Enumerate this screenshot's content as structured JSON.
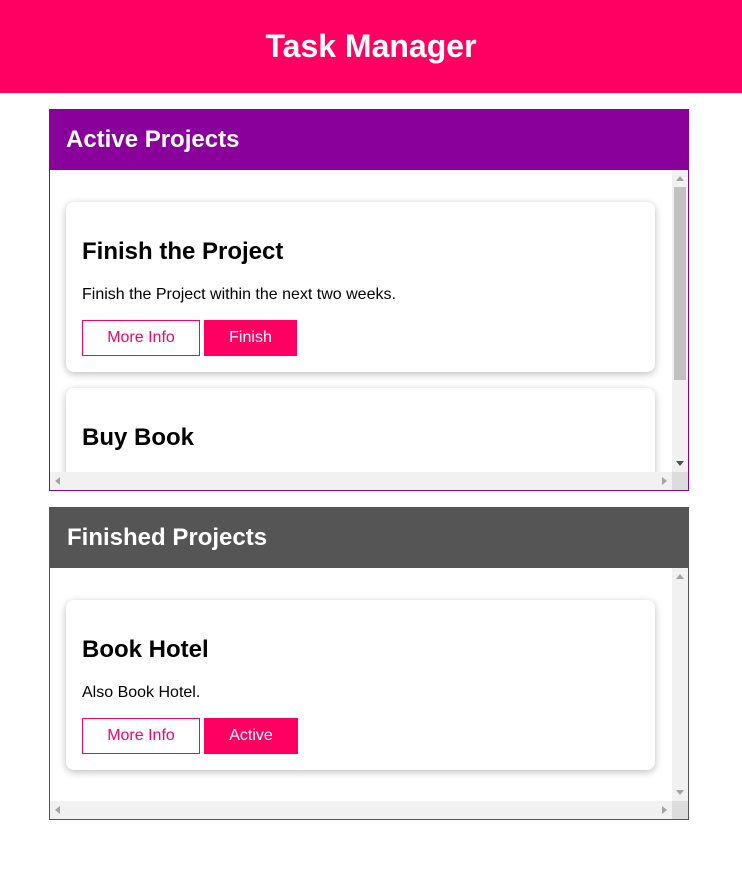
{
  "app": {
    "title": "Task Manager",
    "accent_color": "#ff0062"
  },
  "active_section": {
    "title": "Active Projects",
    "header_color": "#89009a",
    "projects": [
      {
        "title": "Finish the Project",
        "description": "Finish the Project within the next two weeks.",
        "more_info_label": "More Info",
        "action_label": "Finish"
      },
      {
        "title": "Buy Book"
      }
    ]
  },
  "finished_section": {
    "title": "Finished Projects",
    "header_color": "#555555",
    "projects": [
      {
        "title": "Book Hotel",
        "description": "Also Book Hotel.",
        "more_info_label": "More Info",
        "action_label": "Active"
      }
    ]
  }
}
